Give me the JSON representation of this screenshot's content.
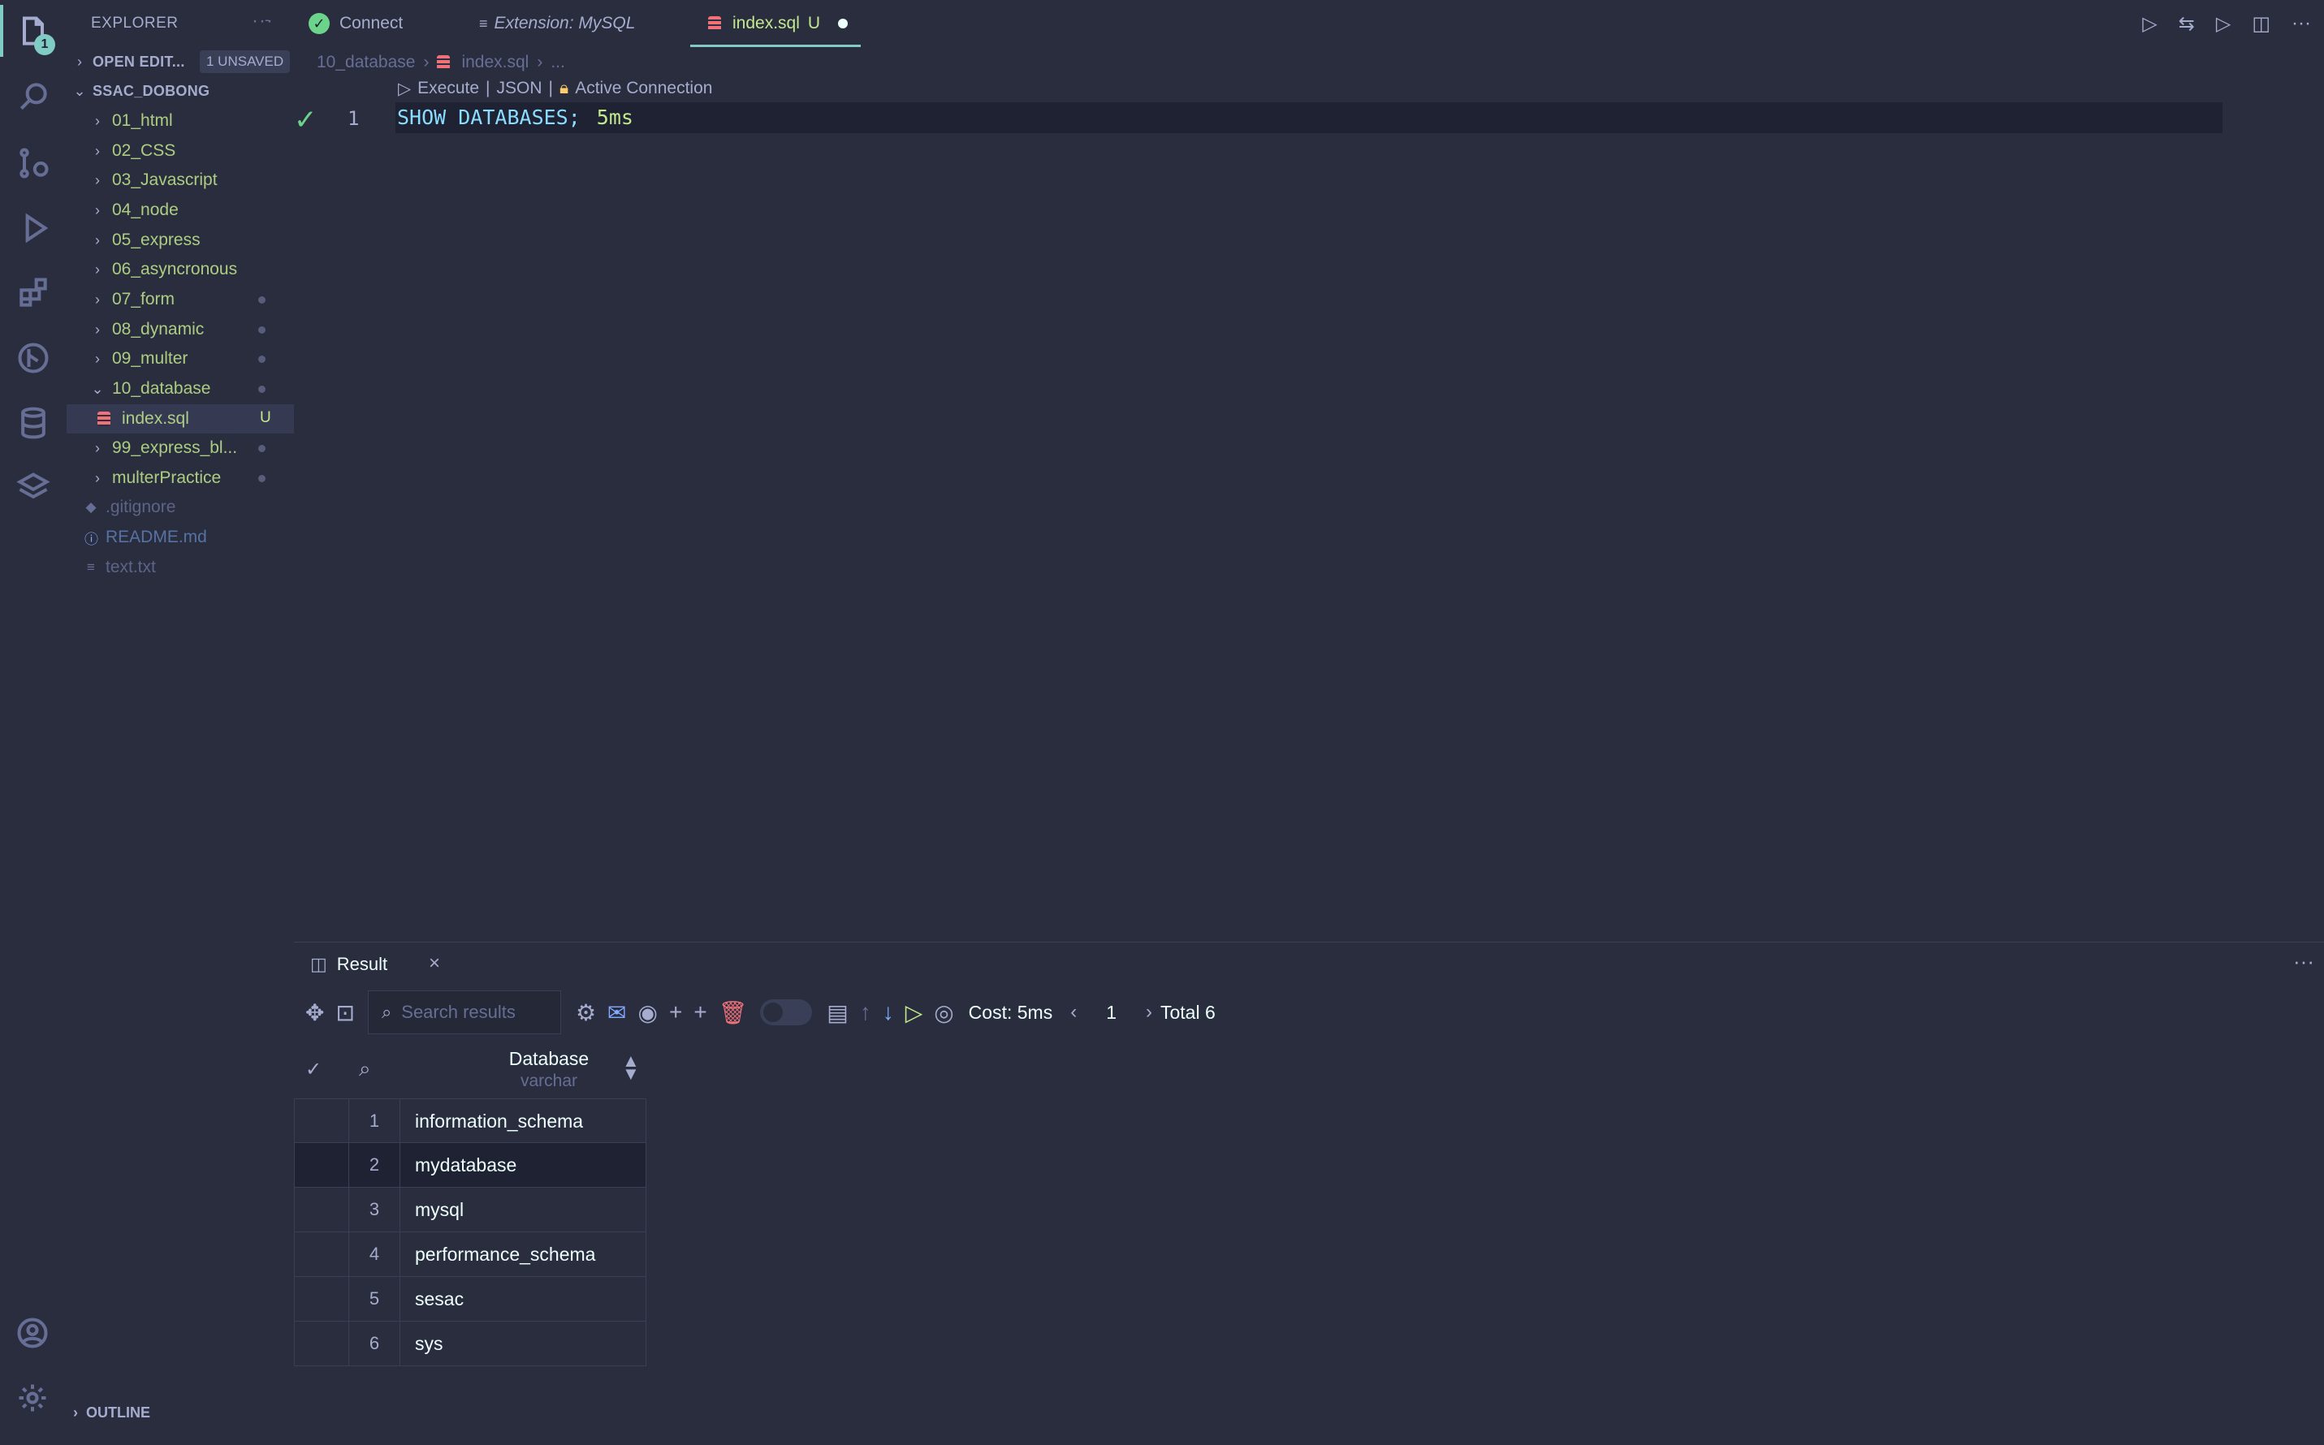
{
  "activity_bar": {
    "explorer_badge": "1"
  },
  "sidebar": {
    "title": "EXPLORER",
    "more": "···",
    "open_editors": {
      "label": "OPEN EDIT...",
      "badge": "1 UNSAVED"
    },
    "workspace": "SSAC_DOBONG",
    "items": [
      {
        "label": "01_html"
      },
      {
        "label": "02_CSS"
      },
      {
        "label": "03_Javascript"
      },
      {
        "label": "04_node"
      },
      {
        "label": "05_express"
      },
      {
        "label": "06_asyncronous"
      },
      {
        "label": "07_form"
      },
      {
        "label": "08_dynamic"
      },
      {
        "label": "09_multer"
      },
      {
        "label": "10_database"
      },
      {
        "label": "index.sql",
        "status": "U"
      },
      {
        "label": "99_express_bl..."
      },
      {
        "label": "multerPractice"
      },
      {
        "label": ".gitignore"
      },
      {
        "label": "README.md"
      },
      {
        "label": "text.txt"
      }
    ],
    "outline": "OUTLINE"
  },
  "tabs": {
    "connect": "Connect",
    "extension": "Extension: MySQL",
    "index": "index.sql",
    "index_status": "U"
  },
  "breadcrumb": {
    "folder": "10_database",
    "file": "index.sql",
    "ellipsis": "..."
  },
  "editor": {
    "codelens": {
      "execute": "Execute",
      "json": "JSON",
      "connection": "Active Connection"
    },
    "line_number": "1",
    "code": "SHOW DATABASES;",
    "duration": "5ms"
  },
  "result_panel": {
    "tab_label": "Result",
    "search_placeholder": "Search results",
    "cost": "Cost: 5ms",
    "page": "1",
    "total": "Total 6",
    "column": {
      "name": "Database",
      "type": "varchar"
    },
    "rows": [
      {
        "n": "1",
        "value": "information_schema"
      },
      {
        "n": "2",
        "value": "mydatabase"
      },
      {
        "n": "3",
        "value": "mysql"
      },
      {
        "n": "4",
        "value": "performance_schema"
      },
      {
        "n": "5",
        "value": "sesac"
      },
      {
        "n": "6",
        "value": "sys"
      }
    ]
  }
}
